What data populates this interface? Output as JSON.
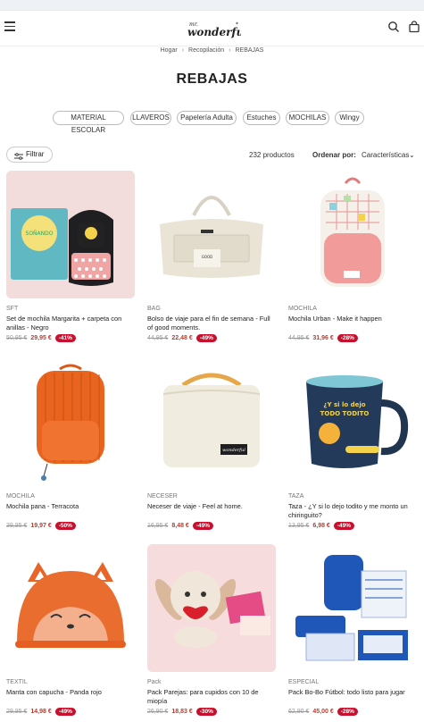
{
  "header": {
    "logo_text": "Mr. Wonderful",
    "icons": [
      "menu-icon",
      "search-icon",
      "bag-icon"
    ]
  },
  "breadcrumb": {
    "items": [
      "Hogar",
      "Recopilación",
      "REBAJAS"
    ]
  },
  "page_title": "REBAJAS",
  "chips": [
    "MATERIAL ESCOLAR",
    "LLAVEROS",
    "Papelería Adulta",
    "Estuches",
    "MOCHILAS",
    "Wingy"
  ],
  "toolbar": {
    "filter_label": "Filtrar",
    "product_count": "232 productos",
    "sort_label": "Ordenar por:",
    "sort_value": "Características"
  },
  "colors": {
    "discount_badge": "#c8102e",
    "sale_price": "#c0392b"
  },
  "products": [
    {
      "category": "SFT",
      "name": "Set de mochila Margarita + carpeta con anillas - Negro",
      "old_price": "50,95 €",
      "price": "29,95 €",
      "discount": "-41%"
    },
    {
      "category": "BAG",
      "name": "Bolso de viaje para el fin de semana - Full of good moments.",
      "old_price": "44,95 €",
      "price": "22,48 €",
      "discount": "-49%"
    },
    {
      "category": "MOCHILA",
      "name": "Mochila Urban - Make it happen",
      "old_price": "44,95 €",
      "price": "31,96 €",
      "discount": "-28%"
    },
    {
      "category": "MOCHILA",
      "name": "Mochila pana - Terracota",
      "old_price": "39,95 €",
      "price": "19,97 €",
      "discount": "-50%"
    },
    {
      "category": "NECESER",
      "name": "Neceser de viaje - Feel at home.",
      "old_price": "16,95 €",
      "price": "8,48 €",
      "discount": "-49%"
    },
    {
      "category": "TAZA",
      "name": "Taza - ¿Y si lo dejo todito y me monto un chiringuito?",
      "old_price": "13,95 €",
      "price": "6,98 €",
      "discount": "-49%"
    },
    {
      "category": "TEXTIL",
      "name": "Manta con capucha - Panda rojo",
      "old_price": "29,95 €",
      "price": "14,98 €",
      "discount": "-49%"
    },
    {
      "category": "Pack",
      "name": "Pack Parejas: para cupidos con 10 de miopía",
      "old_price": "26,90 €",
      "price": "18,83 €",
      "discount": "-30%"
    },
    {
      "category": "ESPECIAL",
      "name": "Pack Bo-Bo Fútbol: todo listo para jugar",
      "old_price": "62,90 €",
      "price": "45,00 €",
      "discount": "-28%"
    }
  ]
}
